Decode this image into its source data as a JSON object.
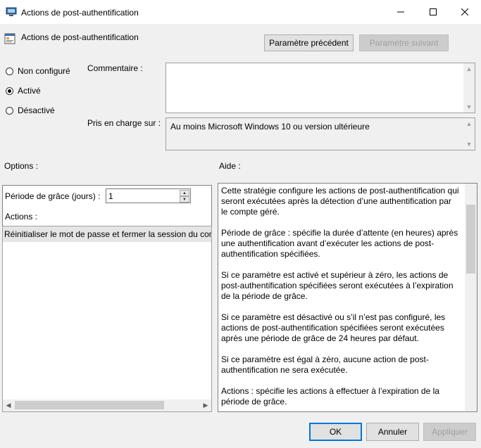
{
  "window": {
    "title": "Actions de post-authentification",
    "minimize_icon": "minimize-icon",
    "maximize_icon": "maximize-icon",
    "close_icon": "close-icon"
  },
  "header": {
    "title": "Actions de post-authentification",
    "prev_button": "Paramètre précédent",
    "next_button": "Paramètre suivant"
  },
  "state": {
    "options": [
      "Non configuré",
      "Activé",
      "Désactivé"
    ],
    "selected": "Activé"
  },
  "comment": {
    "label": "Commentaire :",
    "value": ""
  },
  "supported": {
    "label": "Pris en charge sur :",
    "value": "Au moins Microsoft Windows 10 ou version ultérieure"
  },
  "options_section": {
    "label": "Options :",
    "grace_label": "Période de grâce (jours) :",
    "grace_value": "1",
    "actions_label": "Actions :",
    "actions_selected": "Réinitialiser le mot de passe et fermer la session du compte géré"
  },
  "help_section": {
    "label": "Aide :",
    "paragraphs": [
      "Cette stratégie configure les actions de post-authentification qui seront exécutées après la détection d’une authentification par le compte géré.",
      "Période de grâce : spécifie la durée d’attente (en heures) après une authentification avant d’exécuter les actions de post-authentification spécifiées.",
      "Si ce paramètre est activé et supérieur à zéro, les actions de post-authentification spécifiées seront exécutées à l’expiration de la période de grâce.",
      "Si ce paramètre est désactivé ou s’il n’est pas configuré, les actions de post-authentification spécifiées seront exécutées après une période de grâce de 24 heures par défaut.",
      "Si ce paramètre est égal à zéro, aucune action de post-authentification ne sera exécutée.",
      "Actions : spécifie les actions à effectuer à l’expiration de la période de grâce."
    ]
  },
  "footer": {
    "ok": "OK",
    "cancel": "Annuler",
    "apply": "Appliquer"
  }
}
